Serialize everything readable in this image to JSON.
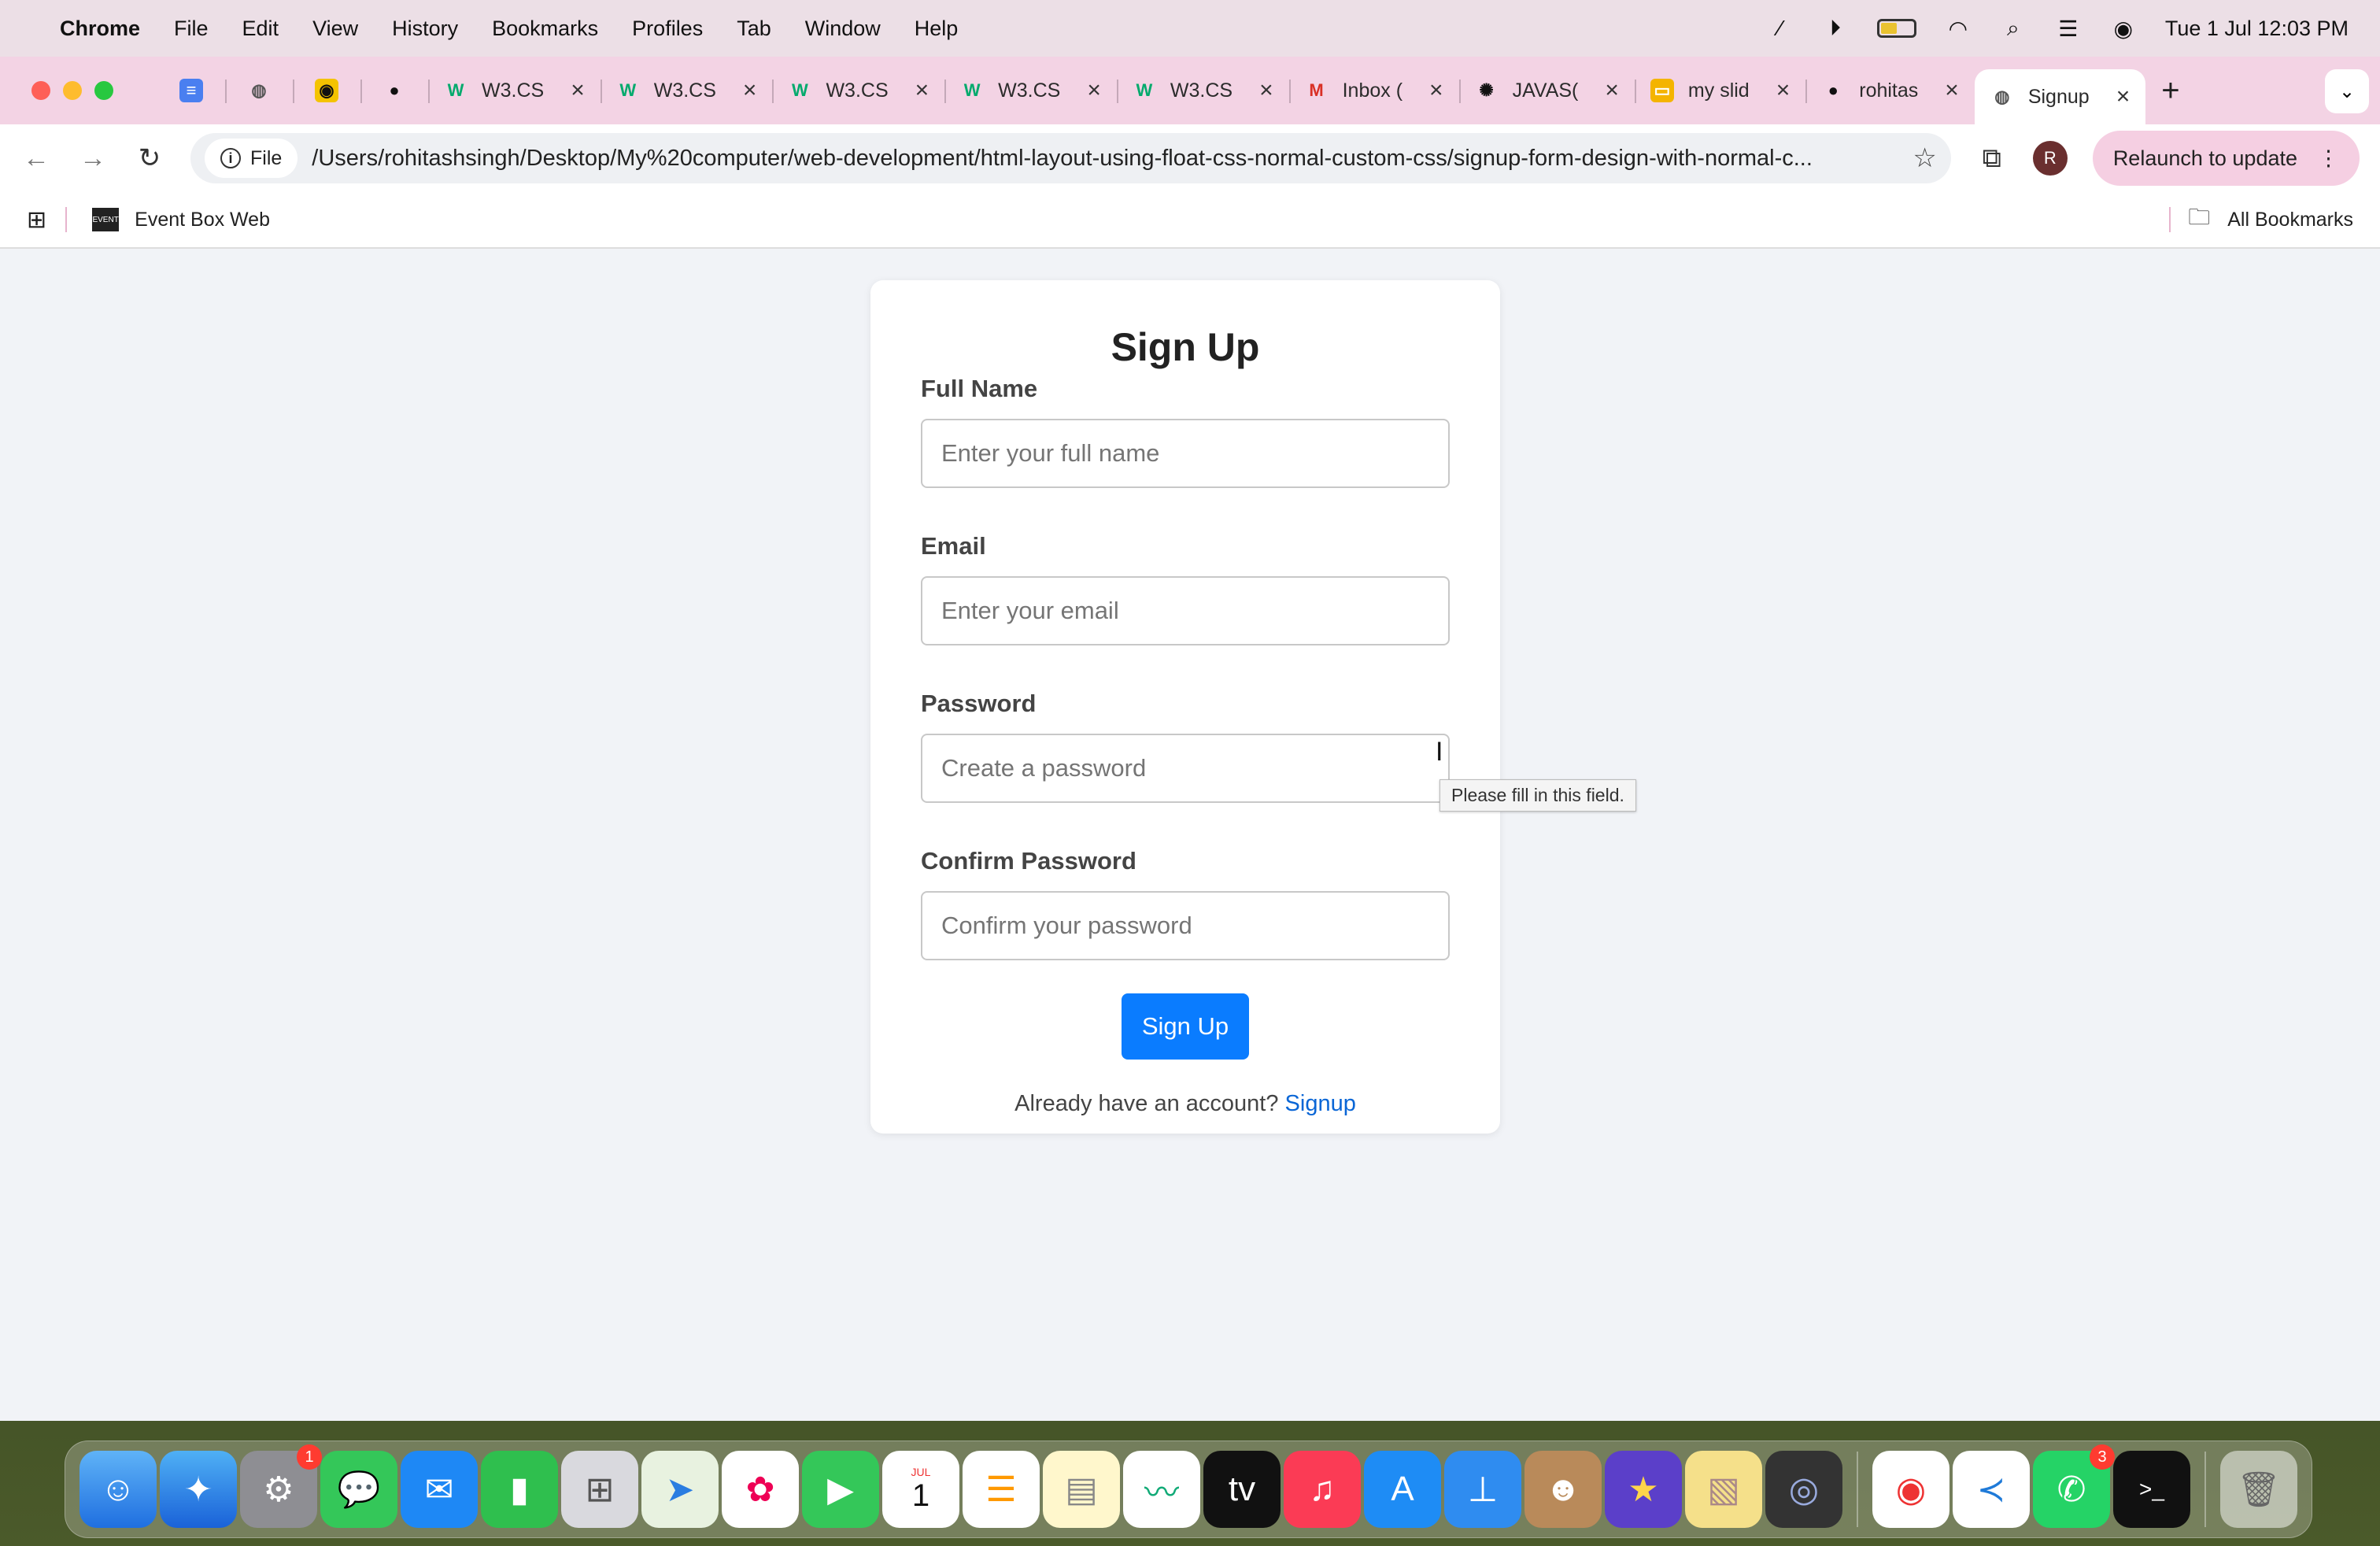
{
  "menubar": {
    "app_name": "Chrome",
    "items": [
      "File",
      "Edit",
      "View",
      "History",
      "Bookmarks",
      "Profiles",
      "Tab",
      "Window",
      "Help"
    ],
    "datetime": "Tue 1 Jul  12:03 PM"
  },
  "tabs": [
    {
      "title": "W3.CS",
      "icon": "w3schools-icon"
    },
    {
      "title": "W3.CS",
      "icon": "w3schools-icon"
    },
    {
      "title": "W3.CS",
      "icon": "w3schools-icon"
    },
    {
      "title": "W3.CS",
      "icon": "w3schools-icon"
    },
    {
      "title": "W3.CS",
      "icon": "w3schools-icon"
    },
    {
      "title": "Inbox (",
      "icon": "gmail-icon"
    },
    {
      "title": "JAVAS(",
      "icon": "chatgpt-icon"
    },
    {
      "title": "my slid",
      "icon": "slides-icon"
    },
    {
      "title": "rohitas",
      "icon": "github-icon"
    },
    {
      "title": "Signup",
      "icon": "globe-icon"
    }
  ],
  "toolbar": {
    "chip_label": "File",
    "url": "/Users/rohitashsingh/Desktop/My%20computer/web-development/html-layout-using-float-css-normal-custom-css/signup-form-design-with-normal-c...",
    "avatar_letter": "R",
    "relaunch_label": "Relaunch to update"
  },
  "bookmarks": {
    "item": "Event Box Web",
    "all": "All Bookmarks"
  },
  "form": {
    "title": "Sign Up",
    "full_name_label": "Full Name",
    "full_name_placeholder": "Enter your full name",
    "email_label": "Email",
    "email_placeholder": "Enter your email",
    "password_label": "Password",
    "password_placeholder": "Create a password",
    "confirm_label": "Confirm Password",
    "confirm_placeholder": "Confirm your password",
    "submit_label": "Sign Up",
    "footer_text": "Already have an account?",
    "footer_link": "Signup",
    "tooltip": "Please fill in this field.",
    "accent_color": "#0a7cff"
  },
  "dock": {
    "badges": {
      "settings": "1",
      "whatsapp": "3"
    },
    "calendar_month": "JUL",
    "calendar_day": "1"
  }
}
